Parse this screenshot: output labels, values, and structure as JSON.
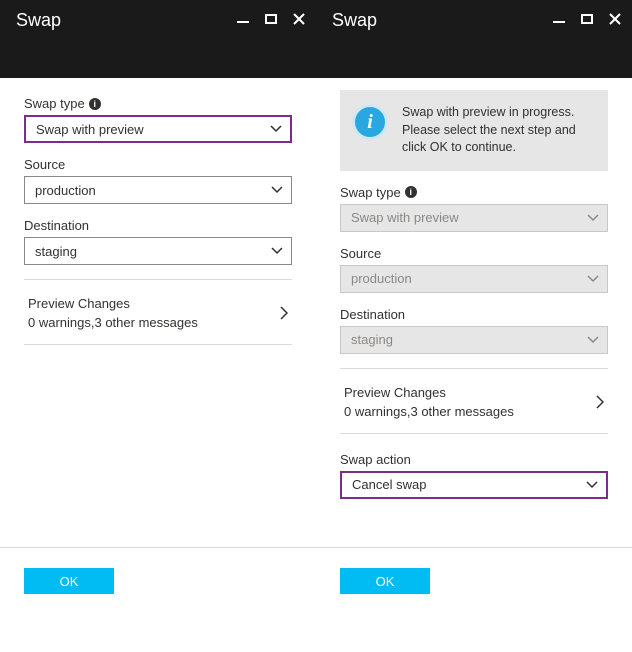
{
  "left": {
    "title": "Swap",
    "swap_type_label": "Swap type",
    "swap_type_value": "Swap with preview",
    "source_label": "Source",
    "source_value": "production",
    "destination_label": "Destination",
    "destination_value": "staging",
    "preview_title": "Preview Changes",
    "preview_sub": "0 warnings,3 other messages",
    "ok_label": "OK"
  },
  "right": {
    "title": "Swap",
    "banner_text": "Swap with preview in progress. Please select the next step and click OK to continue.",
    "swap_type_label": "Swap type",
    "swap_type_value": "Swap with preview",
    "source_label": "Source",
    "source_value": "production",
    "destination_label": "Destination",
    "destination_value": "staging",
    "preview_title": "Preview Changes",
    "preview_sub": "0 warnings,3 other messages",
    "swap_action_label": "Swap action",
    "swap_action_value": "Cancel swap",
    "ok_label": "OK"
  }
}
